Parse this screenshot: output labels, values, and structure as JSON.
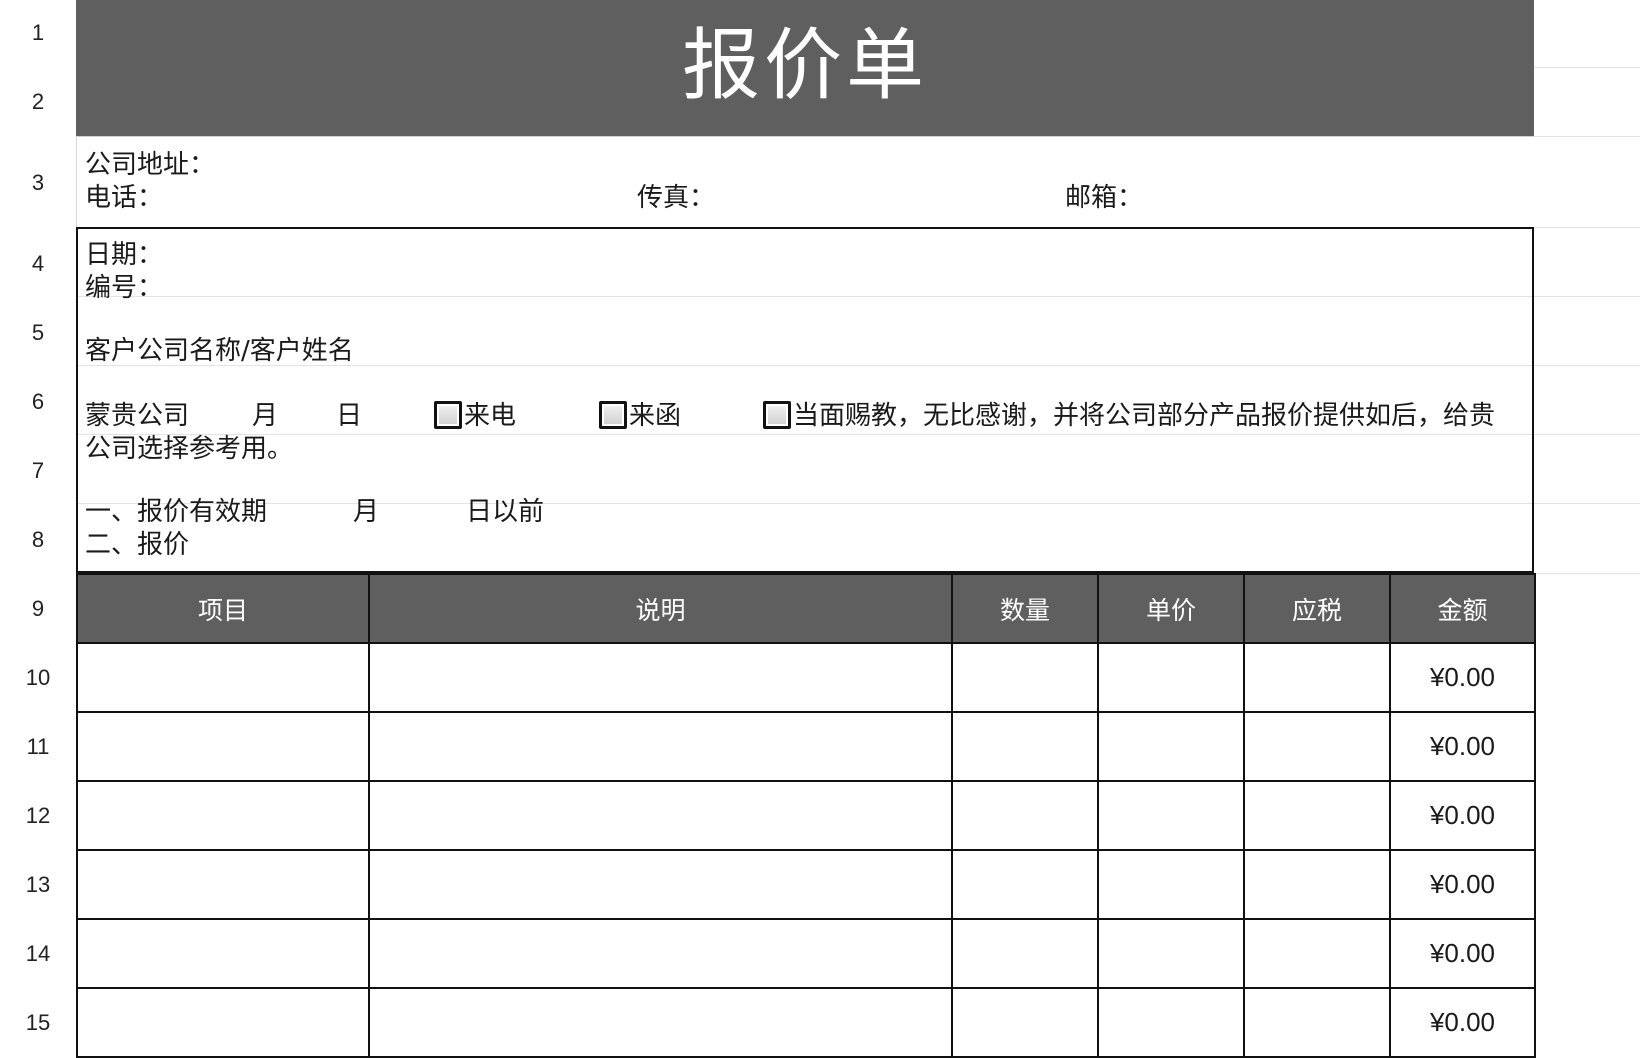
{
  "title": "报价单",
  "row_numbers": [
    "1",
    "2",
    "3",
    "4",
    "5",
    "6",
    "7",
    "8",
    "9",
    "10",
    "11",
    "12",
    "13",
    "14",
    "15"
  ],
  "header_info": {
    "address_label": "公司地址：",
    "phone_label": "电话：",
    "fax_label": "传真：",
    "email_label": "邮箱："
  },
  "info": {
    "date_label": "日期：",
    "number_label": "编号：",
    "customer_label": "客户公司名称/客户姓名",
    "greeting_prefix": "蒙贵公司",
    "month_label": "月",
    "day_label": "日",
    "option_call": "来电",
    "option_letter": "来函",
    "option_visit_text": "当面赐教，无比感谢，并将公司部分产品报价提供如后，给贵",
    "greeting_line2": "公司选择参考用。",
    "validity_prefix": "一、报价有效期",
    "validity_month": "月",
    "validity_suffix": "日以前",
    "quote_label": "二、报价"
  },
  "table": {
    "headers": [
      "项目",
      "说明",
      "数量",
      "单价",
      "应税",
      "金额"
    ],
    "rows": [
      {
        "amount": "¥0.00"
      },
      {
        "amount": "¥0.00"
      },
      {
        "amount": "¥0.00"
      },
      {
        "amount": "¥0.00"
      },
      {
        "amount": "¥0.00"
      },
      {
        "amount": "¥0.00"
      }
    ]
  },
  "colors": {
    "header_bg": "#5f5f5f",
    "header_text": "#ffffff",
    "border": "#111111"
  }
}
